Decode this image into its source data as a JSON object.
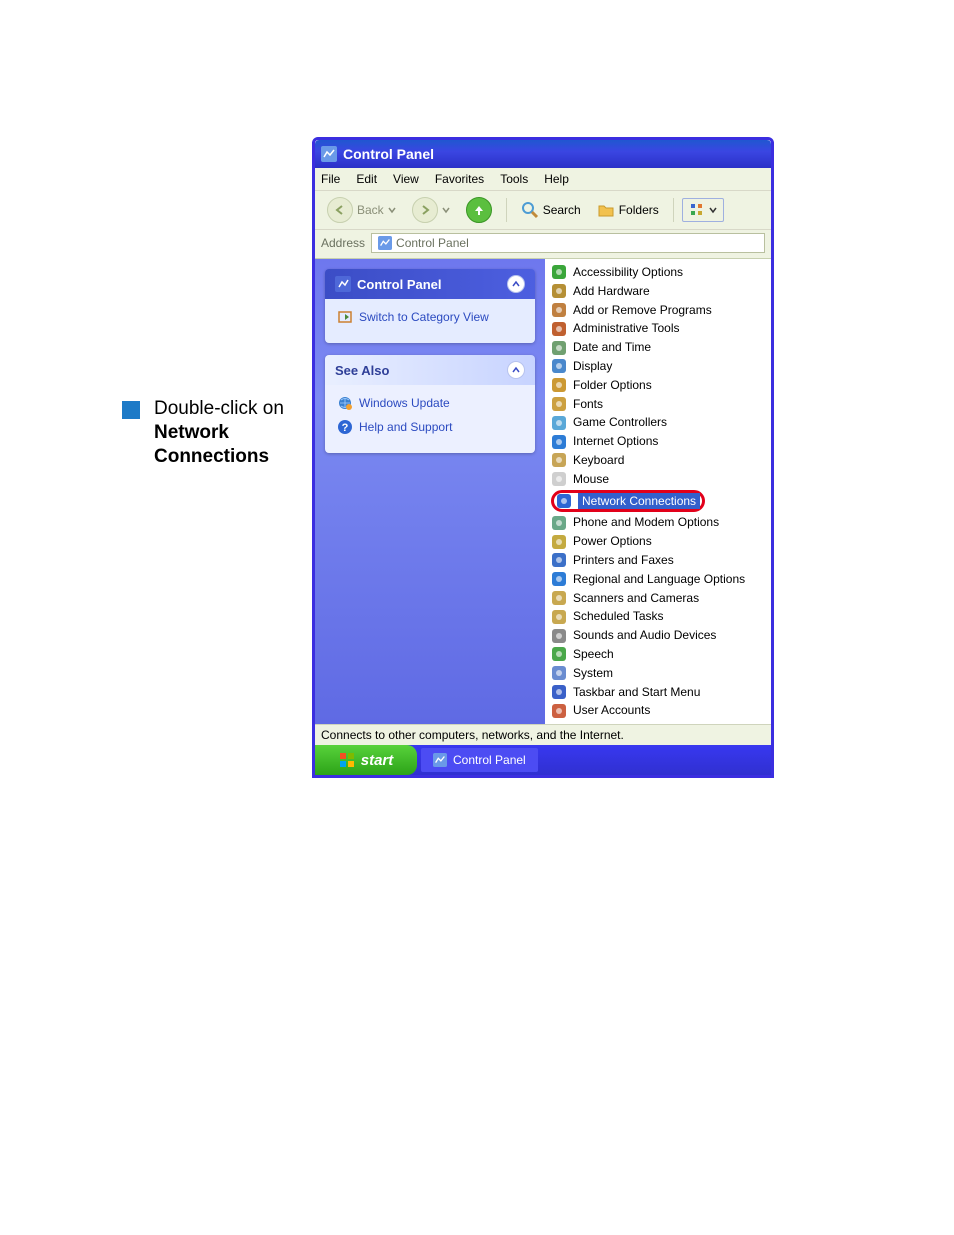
{
  "instructions": {
    "line1": "Double-click on",
    "line2_bold": "Network Connections"
  },
  "window": {
    "title": "Control Panel",
    "menus": [
      "File",
      "Edit",
      "View",
      "Favorites",
      "Tools",
      "Help"
    ],
    "toolbar": {
      "back_label": "Back",
      "search_label": "Search",
      "folders_label": "Folders"
    },
    "addressbar": {
      "label": "Address",
      "value": "Control Panel"
    },
    "left": {
      "panel_title": "Control Panel",
      "switch_link": "Switch to Category View",
      "see_also_title": "See Also",
      "see_also_items": [
        "Windows Update",
        "Help and Support"
      ]
    },
    "items": [
      "Accessibility Options",
      "Add Hardware",
      "Add or Remove Programs",
      "Administrative Tools",
      "Date and Time",
      "Display",
      "Folder Options",
      "Fonts",
      "Game Controllers",
      "Internet Options",
      "Keyboard",
      "Mouse",
      "Network Connections",
      "Phone and Modem Options",
      "Power Options",
      "Printers and Faxes",
      "Regional and Language Options",
      "Scanners and Cameras",
      "Scheduled Tasks",
      "Sounds and Audio Devices",
      "Speech",
      "System",
      "Taskbar and Start Menu",
      "User Accounts"
    ],
    "highlight_index": 12,
    "statusbar": "Connects to other computers, networks, and the Internet.",
    "taskbar": {
      "start_label": "start",
      "task_item": "Control Panel"
    }
  },
  "icons": {
    "colors": [
      "#3aa63a",
      "#b58f35",
      "#c08040",
      "#c06030",
      "#70a070",
      "#4a88cc",
      "#cc9933",
      "#cca040",
      "#5aa8d8",
      "#2d7cd6",
      "#c7a557",
      "#cfcfcf",
      "#2d66d4",
      "#6aa888",
      "#c4aa40",
      "#3c70c8",
      "#2d7cd6",
      "#c8a850",
      "#c8a850",
      "#8a8a8a",
      "#4aa84a",
      "#6a8cd0",
      "#3a60c8",
      "#cc6040"
    ]
  }
}
